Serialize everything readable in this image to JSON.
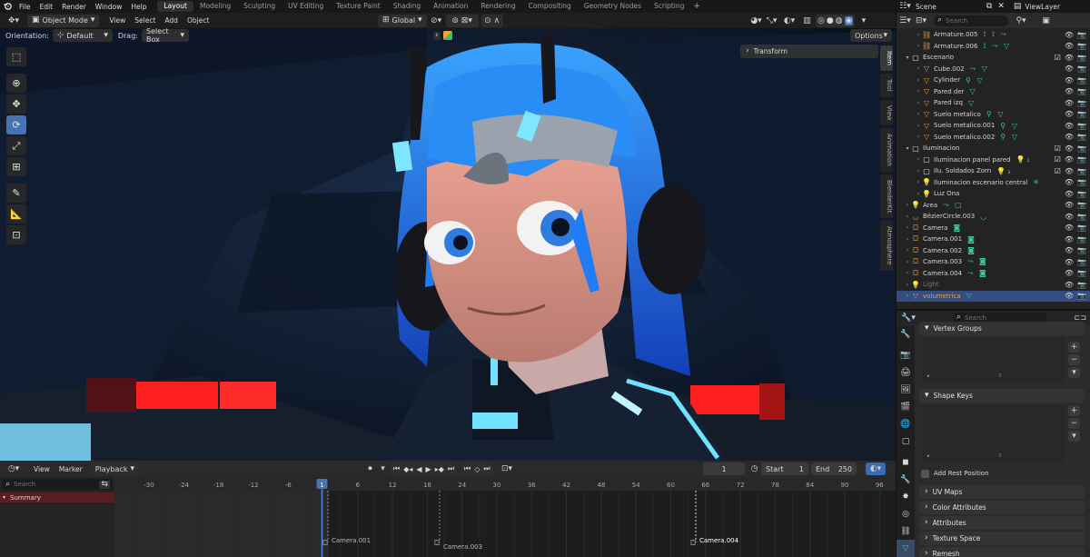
{
  "topbar": {
    "menus": [
      "File",
      "Edit",
      "Render",
      "Window",
      "Help"
    ],
    "workspaces": [
      "Layout",
      "Modeling",
      "Sculpting",
      "UV Editing",
      "Texture Paint",
      "Shading",
      "Animation",
      "Rendering",
      "Compositing",
      "Geometry Nodes",
      "Scripting"
    ],
    "active_workspace": "Layout",
    "add_tab": "+",
    "scene": "Scene",
    "view_layer": "ViewLayer"
  },
  "viewport_header": {
    "mode": "Object Mode",
    "menus": [
      "View",
      "Select",
      "Add",
      "Object"
    ],
    "transform_orientation": "Global",
    "options": "Options"
  },
  "viewport_header2": {
    "orientation_label": "Orientation:",
    "orientation_value": "Default",
    "drag_label": "Drag:",
    "drag_value": "Select Box"
  },
  "sidebar": {
    "transform_panel": "Transform",
    "tabs": [
      "Item",
      "Tool",
      "View",
      "Animation",
      "BlenderKit",
      "Atmosphere"
    ],
    "active_tab": "Item"
  },
  "toolbar": {
    "tools": [
      "select-box-icon",
      "cursor-icon",
      "move-icon",
      "rotate-icon",
      "scale-icon",
      "transform-icon",
      "annotate-icon",
      "measure-icon",
      "add-cube-icon"
    ],
    "active_index": 3
  },
  "timeline": {
    "menus": [
      "View",
      "Marker"
    ],
    "playback": "Playback",
    "current_frame": "1",
    "start_label": "Start",
    "start": "1",
    "end_label": "End",
    "end": "250",
    "search_placeholder": "Search",
    "summary": "Summary",
    "ruler": [
      "-30",
      "-24",
      "-18",
      "-12",
      "-6",
      "1",
      "6",
      "12",
      "18",
      "24",
      "30",
      "36",
      "42",
      "48",
      "54",
      "60",
      "66",
      "72",
      "78",
      "84",
      "90",
      "96"
    ],
    "markers": [
      "Camera.001",
      "Camera.003",
      "Camera.004"
    ]
  },
  "outliner": {
    "search_placeholder": "Search",
    "rows": [
      {
        "label": "Armature.005",
        "indent": 2,
        "icon": "armature",
        "mods": "⟟ ⟟ ⤳",
        "eye": true,
        "cam": true,
        "expand": true
      },
      {
        "label": "Armature.006",
        "indent": 2,
        "icon": "armature",
        "mods": "⟟ ⤳ ▽",
        "eye": true,
        "cam": true,
        "expand": true
      },
      {
        "label": "Escenario",
        "indent": 1,
        "icon": "collection",
        "mods": "",
        "eye": true,
        "cam": true,
        "check": true,
        "expand": true,
        "open": true
      },
      {
        "label": "Cube.002",
        "indent": 2,
        "icon": "mesh",
        "mods": "⤳ ▽",
        "eye": true,
        "cam": true,
        "expand": true
      },
      {
        "label": "Cylinder",
        "indent": 2,
        "icon": "mesh",
        "mods": "⚲ ▽",
        "eye": true,
        "cam": true,
        "expand": true
      },
      {
        "label": "Pared der",
        "indent": 2,
        "icon": "mesh",
        "mods": "▽",
        "eye": true,
        "cam": true,
        "expand": true
      },
      {
        "label": "Pared izq",
        "indent": 2,
        "icon": "mesh",
        "mods": "▽",
        "eye": true,
        "cam": true,
        "expand": true
      },
      {
        "label": "Suelo metalico",
        "indent": 2,
        "icon": "mesh",
        "mods": "⚲ ▽",
        "eye": true,
        "cam": true,
        "expand": true
      },
      {
        "label": "Suelo metalico.001",
        "indent": 2,
        "icon": "mesh",
        "mods": "⚲ ▽",
        "eye": true,
        "cam": true,
        "expand": true
      },
      {
        "label": "Suelo metalico.002",
        "indent": 2,
        "icon": "mesh",
        "mods": "⚲ ▽",
        "eye": true,
        "cam": true,
        "expand": true
      },
      {
        "label": "Iluminacion",
        "indent": 1,
        "icon": "collection",
        "mods": "",
        "eye": true,
        "cam": true,
        "check": true,
        "expand": true,
        "open": true
      },
      {
        "label": "Iluminacion panel pared",
        "indent": 2,
        "icon": "collection",
        "mods": "💡₂",
        "eye": true,
        "cam": true,
        "check": true,
        "expand": true
      },
      {
        "label": "Ilu. Soldados Zorn",
        "indent": 2,
        "icon": "collection",
        "mods": "💡₃",
        "eye": true,
        "cam": true,
        "check": true,
        "expand": true
      },
      {
        "label": "Iluminacion escenario central",
        "indent": 2,
        "icon": "light",
        "mods": "✳",
        "eye": true,
        "cam": true,
        "expand": true
      },
      {
        "label": "Luz Ona",
        "indent": 2,
        "icon": "light",
        "mods": "",
        "eye": true,
        "cam": true,
        "expand": true
      },
      {
        "label": "Area",
        "indent": 1,
        "icon": "light",
        "mods": "⤳ ▢",
        "eye": true,
        "cam": true,
        "expand": true
      },
      {
        "label": "BézierCircle.003",
        "indent": 1,
        "icon": "curve",
        "mods": "◡",
        "eye": true,
        "cam": true,
        "expand": true
      },
      {
        "label": "Camera",
        "indent": 1,
        "icon": "camera",
        "mods": "◙",
        "eye": true,
        "cam": true,
        "expand": true
      },
      {
        "label": "Camera.001",
        "indent": 1,
        "icon": "camera",
        "mods": "◙",
        "eye": true,
        "cam": true,
        "expand": true
      },
      {
        "label": "Camera.002",
        "indent": 1,
        "icon": "camera",
        "mods": "◙",
        "eye": true,
        "cam": true,
        "expand": true
      },
      {
        "label": "Camera.003",
        "indent": 1,
        "icon": "camera",
        "mods": "⤳ ◙",
        "eye": true,
        "cam": true,
        "expand": true
      },
      {
        "label": "Camera.004",
        "indent": 1,
        "icon": "camera",
        "mods": "⤳ ◙",
        "eye": true,
        "cam": true,
        "expand": true
      },
      {
        "label": "Light",
        "indent": 1,
        "icon": "light",
        "mods": "",
        "eye": true,
        "cam": true,
        "expand": true,
        "dim": true
      },
      {
        "label": "volumetrica",
        "indent": 1,
        "icon": "mesh",
        "mods": "▽",
        "eye": true,
        "cam": true,
        "expand": true,
        "selected": true
      }
    ]
  },
  "properties": {
    "search_placeholder": "Search",
    "vertex_groups": "Vertex Groups",
    "shape_keys": "Shape Keys",
    "add_rest_position": "Add Rest Position",
    "collapsed_panels": [
      "UV Maps",
      "Color Attributes",
      "Attributes",
      "Texture Space",
      "Remesh"
    ],
    "tabs": [
      "tool-icon",
      "render-icon",
      "output-icon",
      "view-layer-icon",
      "scene-icon",
      "world-icon",
      "collection-icon",
      "object-icon",
      "modifier-icon",
      "particles-icon",
      "physics-icon",
      "constraints-icon",
      "data-icon"
    ]
  }
}
